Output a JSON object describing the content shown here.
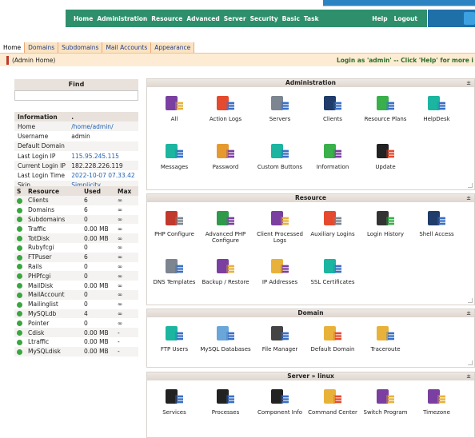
{
  "topnav": {
    "items": [
      "Home",
      "Administration",
      "Resource",
      "Advanced",
      "Server",
      "Security",
      "Basic",
      "Task"
    ],
    "help": "Help",
    "logout": "Logout",
    "color": "#2e8f6c"
  },
  "tabs": [
    "Home",
    "Domains",
    "Subdomains",
    "Mail Accounts",
    "Appearance"
  ],
  "breadcrumb": "(Admin Home)",
  "login_notice": "Login as 'admin' -- Click 'Help' for more i",
  "find": {
    "title": "Find",
    "value": ""
  },
  "info": {
    "header": [
      "Information",
      "."
    ],
    "rows": [
      [
        "Home",
        "/home/admin/"
      ],
      [
        "Username",
        "admin"
      ],
      [
        "Default Domain",
        ""
      ],
      [
        "Last Login IP",
        "115.95.245.115"
      ],
      [
        "Current Login IP",
        "182.228.226.119"
      ],
      [
        "Last Login Time",
        "2022-10-07 07.33.42"
      ],
      [
        "Skin",
        "Simplicity"
      ]
    ]
  },
  "resources": {
    "header": [
      "S",
      "Resource",
      "Used",
      "Max"
    ],
    "rows": [
      [
        "Clients",
        "6",
        "∞"
      ],
      [
        "Domains",
        "6",
        "∞"
      ],
      [
        "Subdomains",
        "0",
        "∞"
      ],
      [
        "Traffic",
        "0.00 MB",
        "∞"
      ],
      [
        "TotDisk",
        "0.00 MB",
        "∞"
      ],
      [
        "Rubyfcgi",
        "0",
        "∞"
      ],
      [
        "FTPuser",
        "6",
        "∞"
      ],
      [
        "Rails",
        "0",
        "∞"
      ],
      [
        "PHPfcgi",
        "0",
        "∞"
      ],
      [
        "MailDisk",
        "0.00 MB",
        "∞"
      ],
      [
        "MailAccount",
        "0",
        "∞"
      ],
      [
        "Mailinglist",
        "0",
        "∞"
      ],
      [
        "MySQLdb",
        "4",
        "∞"
      ],
      [
        "Pointer",
        "0",
        "∞"
      ],
      [
        "Cdisk",
        "0.00 MB",
        "-"
      ],
      [
        "Ltraffic",
        "0.00 MB",
        "-"
      ],
      [
        "MySQLdisk",
        "0.00 MB",
        "-"
      ]
    ]
  },
  "panels": [
    {
      "title": "Administration",
      "items": [
        {
          "label": "All",
          "icon": "users-icon"
        },
        {
          "label": "Action Logs",
          "icon": "logs-icon"
        },
        {
          "label": "Servers",
          "icon": "servers-icon"
        },
        {
          "label": "Clients",
          "icon": "clients-icon"
        },
        {
          "label": "Resource Plans",
          "icon": "resource-plans-icon"
        },
        {
          "label": "HelpDesk",
          "icon": "helpdesk-icon"
        },
        {
          "label": "Messages",
          "icon": "messages-icon"
        },
        {
          "label": "Password",
          "icon": "password-icon"
        },
        {
          "label": "Custom Buttons",
          "icon": "custom-buttons-icon"
        },
        {
          "label": "Information",
          "icon": "information-icon"
        },
        {
          "label": "Update",
          "icon": "update-icon"
        }
      ]
    },
    {
      "title": "Resource",
      "items": [
        {
          "label": "PHP Configure",
          "icon": "php-icon"
        },
        {
          "label": "Advanced PHP Configure",
          "icon": "advanced-php-icon"
        },
        {
          "label": "Client Processed Logs",
          "icon": "processed-logs-icon"
        },
        {
          "label": "Auxiliary Logins",
          "icon": "auxiliary-logins-icon"
        },
        {
          "label": "Login History",
          "icon": "login-history-icon"
        },
        {
          "label": "Shell Access",
          "icon": "shell-access-icon"
        },
        {
          "label": "DNS Templates",
          "icon": "dns-templates-icon"
        },
        {
          "label": "Backup / Restore",
          "icon": "backup-restore-icon"
        },
        {
          "label": "IP Addresses",
          "icon": "ip-addresses-icon"
        },
        {
          "label": "SSL Certificates",
          "icon": "ssl-certificates-icon"
        }
      ]
    },
    {
      "title": "Domain",
      "items": [
        {
          "label": "FTP Users",
          "icon": "ftp-users-icon"
        },
        {
          "label": "MySQL Databases",
          "icon": "mysql-icon"
        },
        {
          "label": "File Manager",
          "icon": "file-manager-icon"
        },
        {
          "label": "Default Domain",
          "icon": "default-domain-icon"
        },
        {
          "label": "Traceroute",
          "icon": "traceroute-icon"
        }
      ]
    },
    {
      "title": "Server » linux",
      "items": [
        {
          "label": "Services",
          "icon": "services-icon"
        },
        {
          "label": "Processes",
          "icon": "processes-icon"
        },
        {
          "label": "Component Info",
          "icon": "component-info-icon"
        },
        {
          "label": "Command Center",
          "icon": "command-center-icon"
        },
        {
          "label": "Switch Program",
          "icon": "switch-program-icon"
        },
        {
          "label": "Timezone",
          "icon": "timezone-icon"
        }
      ]
    }
  ],
  "collapse_glyph": "±"
}
